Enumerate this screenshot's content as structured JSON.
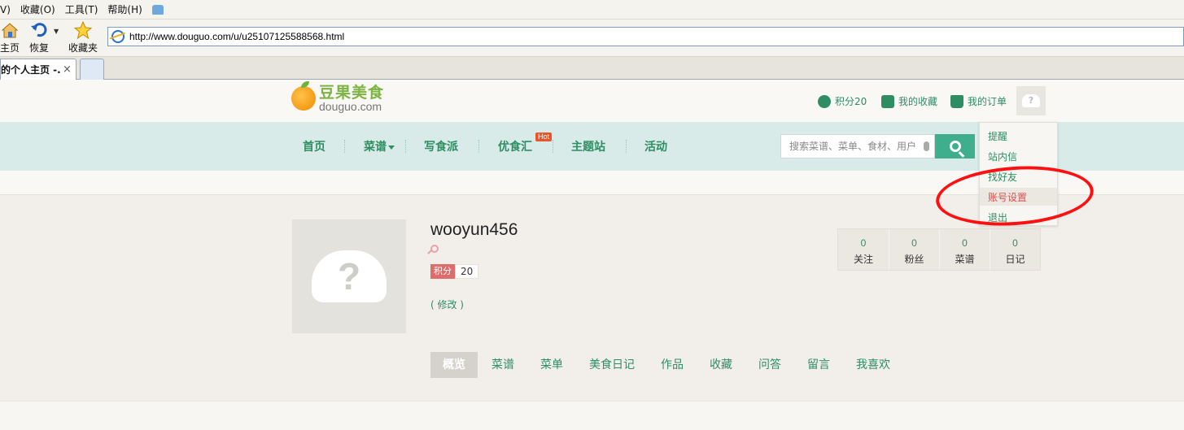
{
  "browser": {
    "menu": [
      "V)",
      "收藏(O)",
      "工具(T)",
      "帮助(H)"
    ],
    "buttons": [
      {
        "label": "主页",
        "icon": "home-icon"
      },
      {
        "label": "恢复",
        "icon": "restore-icon"
      },
      {
        "label": "收藏夹",
        "icon": "star-icon"
      }
    ],
    "address": "http://www.douguo.com/u/u25107125588568.html",
    "tab_title": "的个人主页 -...",
    "tab_close": "×"
  },
  "site": {
    "logo_cn": "豆果美食",
    "logo_en": "douguo.com",
    "utility": {
      "points": "积分20",
      "favorites": "我的收藏",
      "orders": "我的订单"
    },
    "nav": [
      "首页",
      "菜谱",
      "写食派",
      "优食汇",
      "主题站",
      "活动"
    ],
    "hot_badge": "Hot",
    "search_placeholder": "搜索菜谱、菜单、食材、用户"
  },
  "dropdown": [
    "提醒",
    "站内信",
    "找好友",
    "账号设置",
    "退出"
  ],
  "profile": {
    "username": "wooyun456",
    "points_tag": "积分",
    "points_value": "20",
    "edit_link": "( 修改 )",
    "stats": [
      {
        "num": "0",
        "label": "关注"
      },
      {
        "num": "0",
        "label": "粉丝"
      },
      {
        "num": "0",
        "label": "菜谱"
      },
      {
        "num": "0",
        "label": "日记"
      }
    ],
    "tabs": [
      "概览",
      "菜谱",
      "菜单",
      "美食日记",
      "作品",
      "收藏",
      "问答",
      "留言",
      "我喜欢"
    ]
  },
  "colors": {
    "accent": "#2e8d63",
    "nav_bg": "#d8ebe8",
    "search_button": "#3fae8c",
    "annotation": "#ff1010"
  }
}
